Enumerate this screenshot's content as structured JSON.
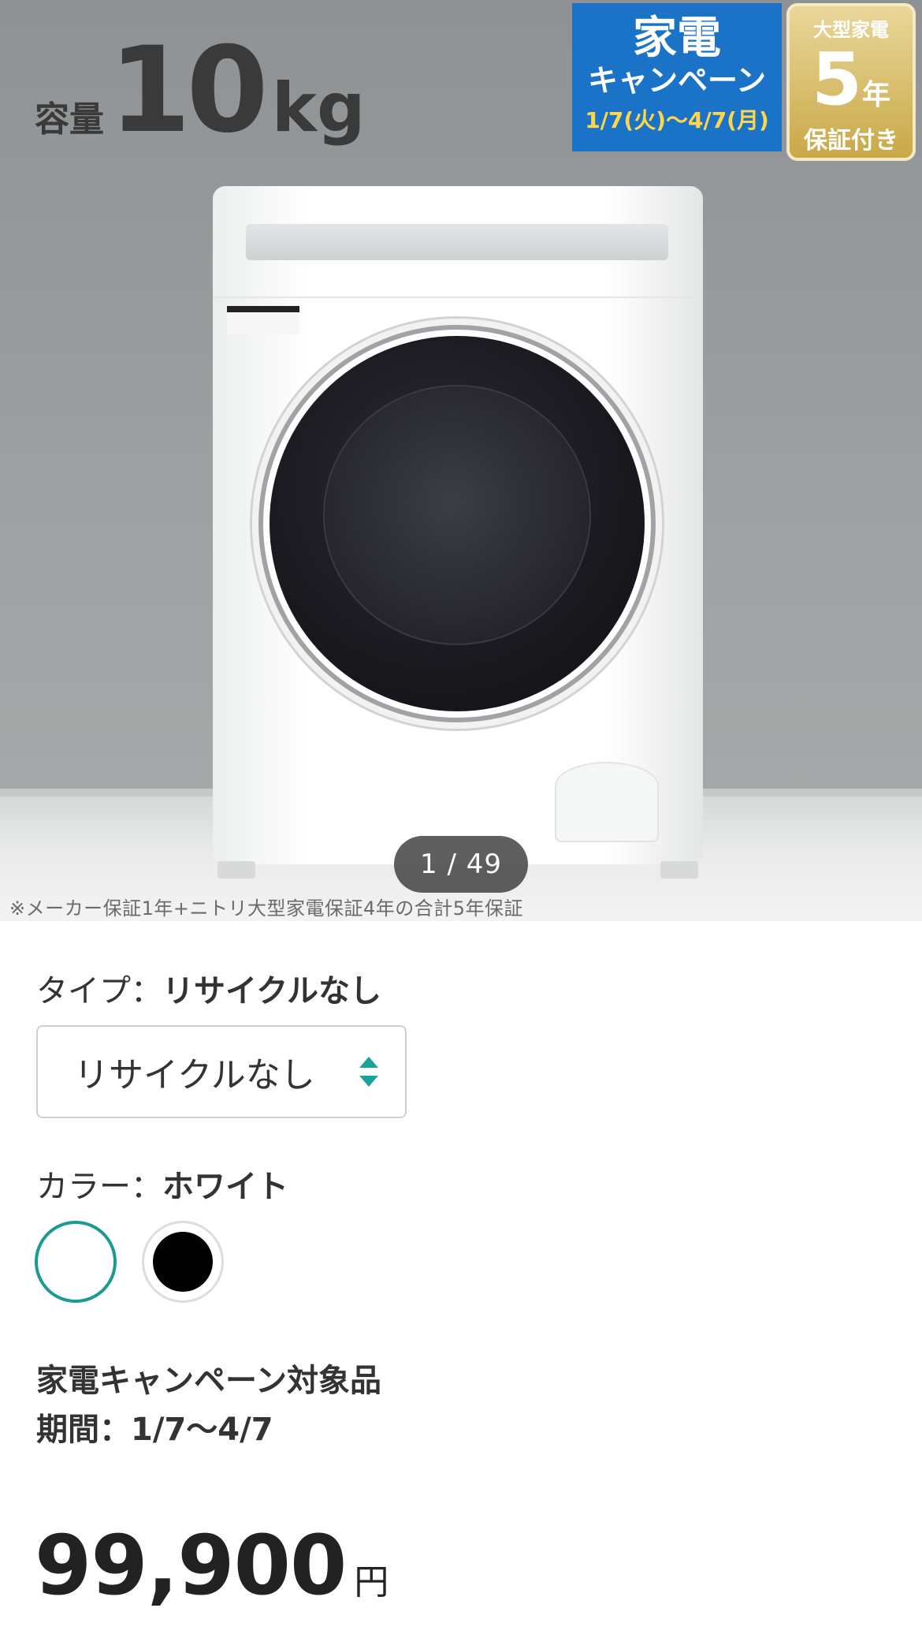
{
  "hero": {
    "capacity_label": "容量",
    "capacity_value": "10",
    "capacity_unit": "kg",
    "campaign_badge": {
      "title": "家電",
      "subtitle": "キャンペーン",
      "dates": "1/7(火)〜4/7(月)"
    },
    "warranty_badge": {
      "top": "大型家電",
      "years": "5",
      "years_unit": "年",
      "bottom": "保証付き"
    },
    "image_counter": "1 / 49",
    "note": "※メーカー保証1年+ニトリ大型家電保証4年の合計5年保証"
  },
  "type": {
    "label": "タイプ：",
    "value": "リサイクルなし",
    "select_value": "リサイクルなし"
  },
  "color": {
    "label": "カラー：",
    "value": "ホワイト",
    "options": [
      "white",
      "black"
    ],
    "selected_border": "#1a9a93"
  },
  "campaign": {
    "line1": "家電キャンペーン対象品",
    "line2": "期間：1/7〜4/7"
  },
  "price": {
    "amount": "99,900",
    "currency": "円"
  },
  "colors": {
    "accent": "#1aa39b",
    "campaign_blue": "#1b73c8"
  }
}
